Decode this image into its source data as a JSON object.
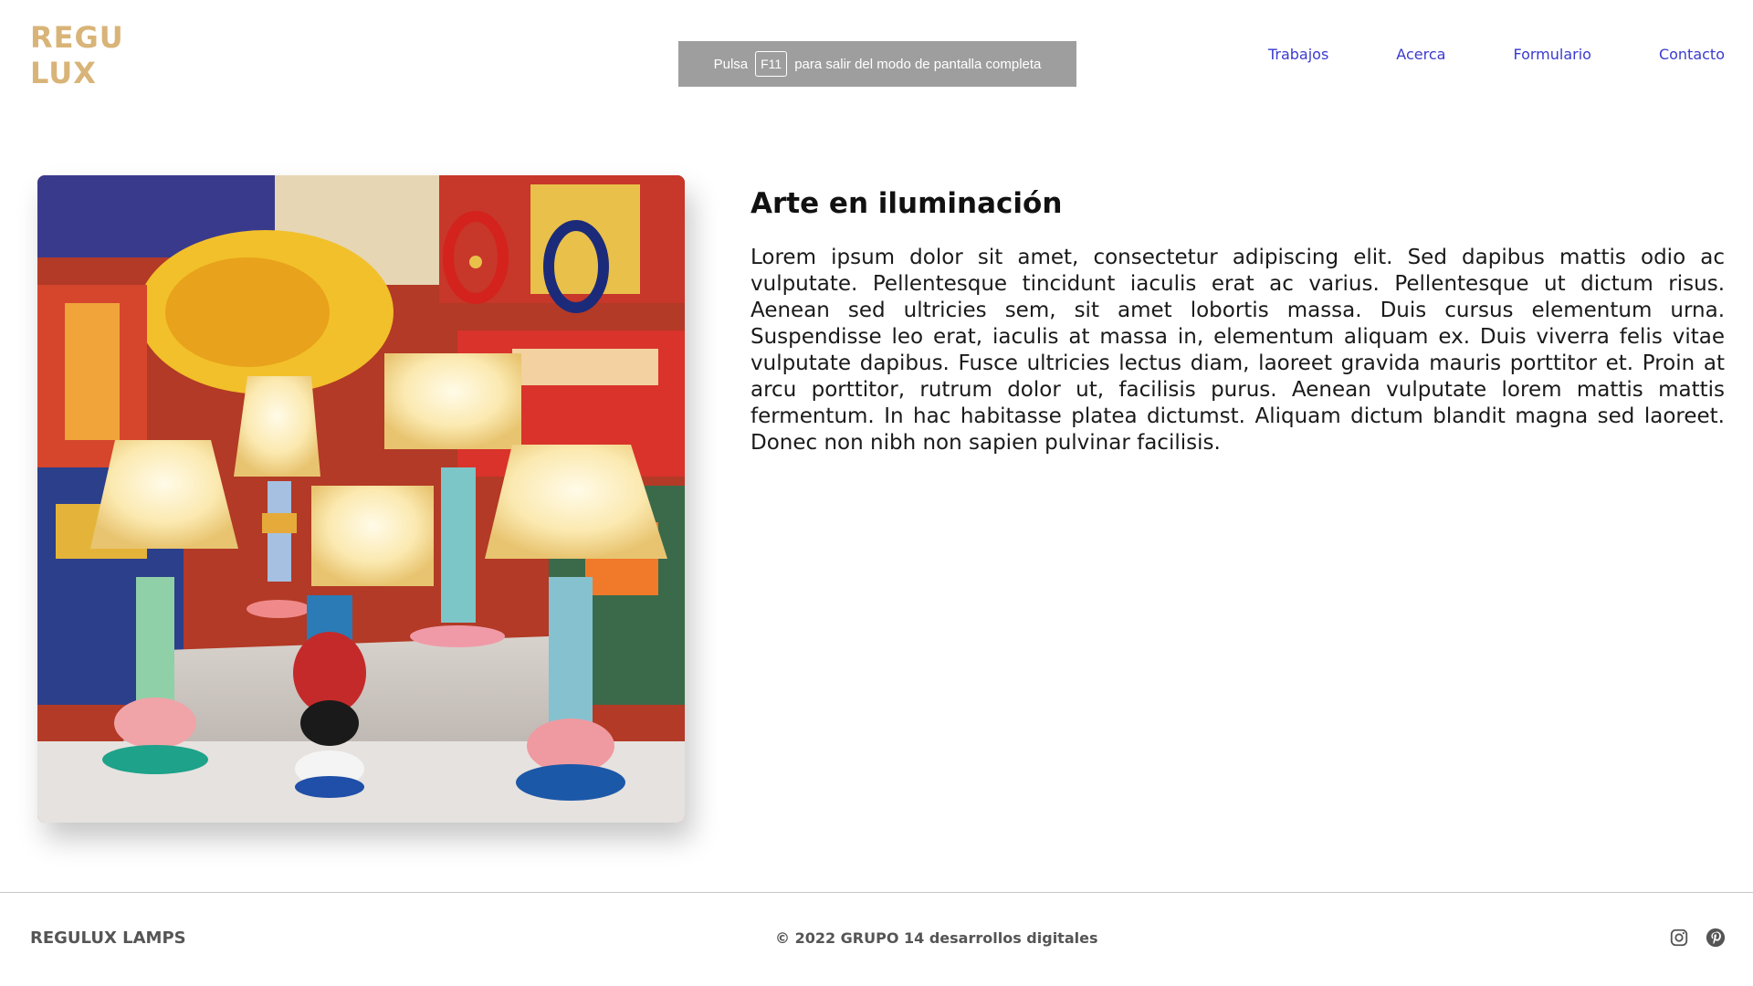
{
  "header": {
    "logo_line1": "REGU",
    "logo_line2": "LUX",
    "nav": [
      {
        "label": "Trabajos"
      },
      {
        "label": "Acerca"
      },
      {
        "label": "Formulario"
      },
      {
        "label": "Contacto"
      }
    ]
  },
  "fullscreen_banner": {
    "text_before": "Pulsa",
    "key": "F11",
    "text_after": "para salir del modo de pantalla completa"
  },
  "main": {
    "image_subject": "colorful table lamps in front of a painted mural",
    "title": "Arte en iluminación",
    "body": "Lorem ipsum dolor sit amet, consectetur adipiscing elit. Sed dapibus mattis odio ac vulputate. Pellentesque tincidunt iaculis erat ac varius. Pellentesque ut dictum risus. Aenean sed ultricies sem, sit amet lobortis massa. Duis cursus elementum urna. Suspendisse leo erat, iaculis at massa in, elementum aliquam ex. Duis viverra felis vitae vulputate dapibus. Fusce ultricies lectus diam, laoreet gravida mauris porttitor et. Proin at arcu porttitor, rutrum dolor ut, facilisis purus. Aenean vulputate lorem mattis mattis fermentum. In hac habitasse platea dictumst. Aliquam dictum blandit magna sed laoreet. Donec non nibh non sapien pulvinar facilisis."
  },
  "footer": {
    "brand": "REGULUX LAMPS",
    "copyright": "© 2022 GRUPO 14 desarrollos digitales",
    "icons": [
      "instagram-icon",
      "pinterest-icon"
    ]
  },
  "colors": {
    "logo": "#d9b478",
    "nav_link": "#3a3ad0",
    "footer_text": "#555555",
    "banner_bg": "#9e9e9e"
  }
}
